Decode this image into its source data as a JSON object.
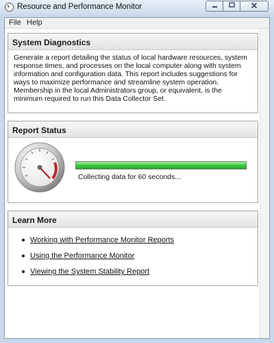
{
  "window": {
    "title": "Resource and Performance Monitor",
    "icon": "monitor-app-icon",
    "controls": [
      "minimize-icon",
      "maximize-icon",
      "close-icon"
    ]
  },
  "menu": {
    "items": [
      "File",
      "Help"
    ]
  },
  "system_diagnostics": {
    "title": "System Diagnostics",
    "description": "Generate a report detailing the status of local hardware resources, system response times, and processes on the local computer along with system information and configuration data. This report includes suggestions for ways to maximize performance and streamline system operation. Membership in the local Administrators group, or equivalent, is the minimum required to run this Data Collector Set."
  },
  "report_status": {
    "title": "Report Status",
    "progress_fraction": 1.0,
    "status_text": "Collecting data for 60 seconds...",
    "progress_color": "#35c43b",
    "icon": "gauge-icon"
  },
  "learn_more": {
    "title": "Learn More",
    "links": [
      "Working with Performance Monitor Reports",
      "Using the Performance Monitor",
      "Viewing the System Stability Report"
    ]
  }
}
